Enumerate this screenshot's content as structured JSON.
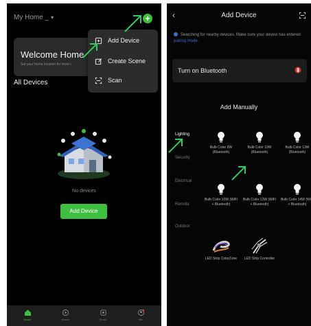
{
  "left": {
    "home_title": "My Home _",
    "home_caret": "▾",
    "plus": "+",
    "welcome": {
      "title": "Welcome Home",
      "subtitle": "Set your home location for more i"
    },
    "menu": [
      {
        "label": "Add Device",
        "icon": "add-device-icon"
      },
      {
        "label": "Create Scene",
        "icon": "create-scene-icon"
      },
      {
        "label": "Scan",
        "icon": "scan-icon"
      }
    ],
    "section_title": "All Devices",
    "empty_text": "No devices",
    "add_button": "Add Device",
    "tabs": [
      {
        "label": "Home",
        "icon": "home-icon",
        "active": true
      },
      {
        "label": "Scene",
        "icon": "scene-icon",
        "active": false
      },
      {
        "label": "Smart",
        "icon": "smart-icon",
        "active": false
      },
      {
        "label": "Me",
        "icon": "me-icon",
        "active": false
      }
    ]
  },
  "right": {
    "title": "Add Device",
    "info_text": "Searching for nearby devices. Make sure your device has entered",
    "info_link": "pairing mode.",
    "bluetooth_label": "Turn on Bluetooth",
    "section_title": "Add Manually",
    "categories": [
      "Lighting",
      "Security",
      "Electrical",
      "Remote",
      "Outdoor"
    ],
    "devices": [
      {
        "label": "Bulb Color 9W (Bluetooth)",
        "icon": "bulb-icon"
      },
      {
        "label": "Bulb Color 10W (Bluetooth)",
        "icon": "bulb-icon"
      },
      {
        "label": "Bulb Color 13W (Bluetooth)",
        "icon": "bulb-icon"
      },
      {
        "label": "Bulb Color 10W (WiFi + Bluetooth)",
        "icon": "bulb-icon"
      },
      {
        "label": "Bulb Color 13W (WiFi + Bluetooth)",
        "icon": "bulb-icon"
      },
      {
        "label": "Bulb Color 14W (WiFi + Bluetooth)",
        "icon": "bulb-icon"
      },
      {
        "label": "LED Strip ColorZone",
        "icon": "led-strip-icon"
      },
      {
        "label": "LED Strip Controller",
        "icon": "led-controller-icon"
      }
    ]
  },
  "colors": {
    "accent": "#3fbf3f",
    "link": "#3b6fd8",
    "annotation_arrow": "#2ecc5a"
  }
}
